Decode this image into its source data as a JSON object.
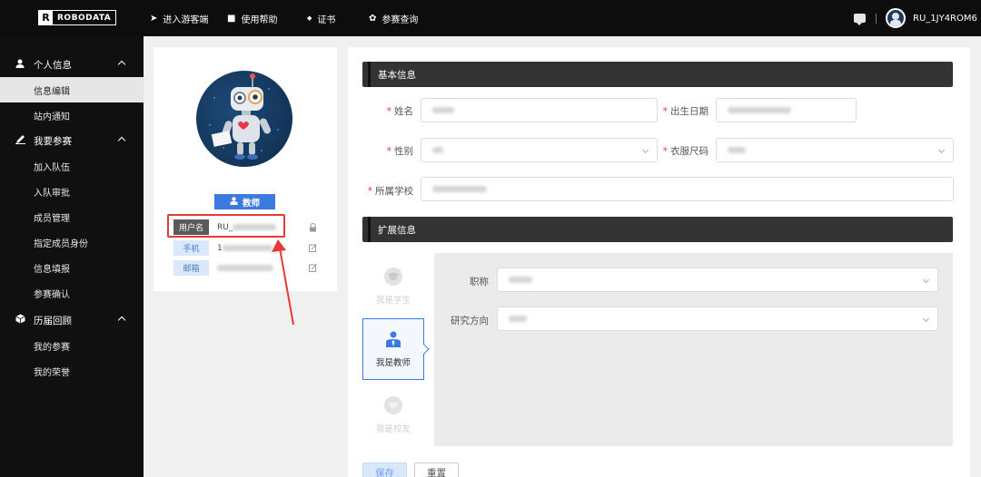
{
  "topbar": {
    "logo_letter": "R",
    "logo_text": "ROBODATA",
    "nav": [
      {
        "icon": "cursor-icon",
        "glyph": "➤",
        "label": "进入游客端"
      },
      {
        "icon": "book-icon",
        "glyph": "■",
        "label": "使用帮助"
      },
      {
        "icon": "diamond-icon",
        "glyph": "◆",
        "label": "证书"
      },
      {
        "icon": "star-icon",
        "glyph": "✿",
        "label": "参赛查询"
      }
    ],
    "username": "RU_1JY4ROM6"
  },
  "sidebar": {
    "groups": [
      {
        "icon": "user-icon",
        "glyph": "👤",
        "label": "个人信息"
      },
      {
        "icon": "edit-icon",
        "glyph": "✎",
        "label": "我要参赛"
      },
      {
        "icon": "cube-icon",
        "glyph": "⬢",
        "label": "历届回顾"
      }
    ],
    "items": [
      {
        "label": "信息编辑",
        "active": true
      },
      {
        "label": "站内通知"
      },
      {
        "label": "加入队伍"
      },
      {
        "label": "入队审批"
      },
      {
        "label": "成员管理"
      },
      {
        "label": "指定成员身份"
      },
      {
        "label": "信息填报"
      },
      {
        "label": "参赛确认"
      },
      {
        "label": "我的参赛"
      },
      {
        "label": "我的荣誉"
      }
    ]
  },
  "profile": {
    "role_label": "教师",
    "username_tag": "用户名",
    "username_value": "RU_",
    "phone_tag": "手机",
    "phone_value": "1",
    "email_tag": "邮箱"
  },
  "basic": {
    "title": "基本信息",
    "name_label": "姓名",
    "birth_label": "出生日期",
    "gender_label": "性别",
    "size_label": "衣服尺码",
    "school_label": "所属学校"
  },
  "extended": {
    "title": "扩展信息",
    "roles": [
      {
        "label": "我是学生",
        "icon": "graduation-cap-icon"
      },
      {
        "label": "我是教师",
        "icon": "teacher-icon"
      },
      {
        "label": "我是校友",
        "icon": "heart-chat-icon"
      }
    ],
    "title_label": "职称",
    "research_label": "研究方向"
  },
  "buttons": {
    "save": "保存",
    "reset": "重置"
  },
  "colors": {
    "accent": "#3d7ae0",
    "required": "#e53935",
    "highlight": "#e53935"
  }
}
